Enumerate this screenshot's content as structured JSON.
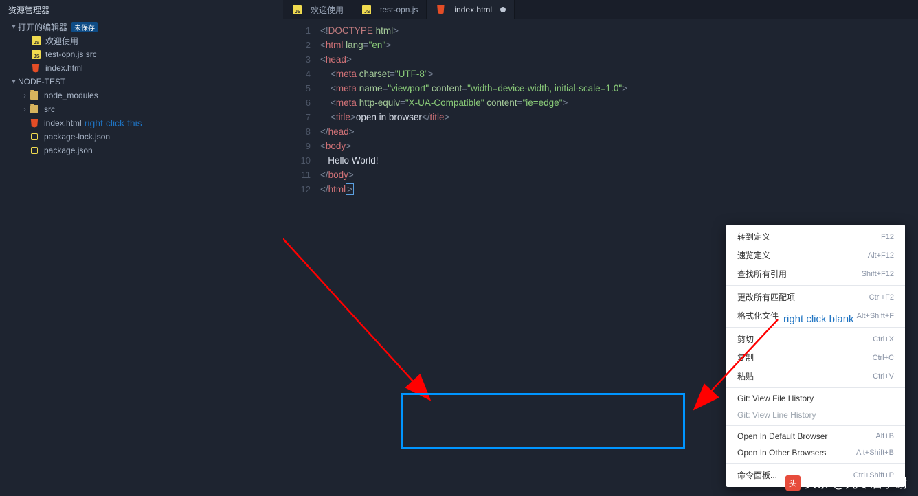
{
  "sidebar": {
    "title": "资源管理器",
    "sections": {
      "openEditors": {
        "label": "打开的编辑器",
        "badge": "未保存"
      },
      "items": [
        {
          "icon": "js",
          "label": "欢迎使用"
        },
        {
          "icon": "js",
          "label": "test-opn.js src"
        },
        {
          "icon": "html5",
          "label": "index.html"
        }
      ],
      "workspace": "NODE-TEST",
      "wsItems": [
        {
          "icon": "folder",
          "label": "node_modules",
          "chev": "›"
        },
        {
          "icon": "folder",
          "label": "src",
          "chev": "›"
        },
        {
          "icon": "html5",
          "label": "index.html",
          "selected": true,
          "annotation": "right click this"
        },
        {
          "icon": "json",
          "label": "package-lock.json"
        },
        {
          "icon": "json",
          "label": "package.json"
        }
      ]
    }
  },
  "tabs": [
    {
      "icon": "js",
      "label": "欢迎使用"
    },
    {
      "icon": "js",
      "label": "test-opn.js"
    },
    {
      "icon": "html5",
      "label": "index.html",
      "active": true,
      "dirty": true
    }
  ],
  "code": {
    "lines": [
      {
        "n": 1,
        "html": [
          [
            "brkt",
            "<!"
          ],
          [
            "doctype",
            "DOCTYPE "
          ],
          [
            "attr",
            "html"
          ],
          [
            "brkt",
            ">"
          ]
        ]
      },
      {
        "n": 2,
        "html": [
          [
            "brkt",
            "<"
          ],
          [
            "tag",
            "html"
          ],
          [
            "txt",
            " "
          ],
          [
            "attr",
            "lang"
          ],
          [
            "brkt",
            "="
          ],
          [
            "str",
            "\"en\""
          ],
          [
            "brkt",
            ">"
          ]
        ]
      },
      {
        "n": 3,
        "html": [
          [
            "brkt",
            "<"
          ],
          [
            "tag",
            "head"
          ],
          [
            "brkt",
            ">"
          ]
        ]
      },
      {
        "n": 4,
        "html": [
          [
            "txt",
            "    "
          ],
          [
            "brkt",
            "<"
          ],
          [
            "tag",
            "meta"
          ],
          [
            "txt",
            " "
          ],
          [
            "attr",
            "charset"
          ],
          [
            "brkt",
            "="
          ],
          [
            "str",
            "\"UTF-8\""
          ],
          [
            "brkt",
            ">"
          ]
        ]
      },
      {
        "n": 5,
        "html": [
          [
            "txt",
            "    "
          ],
          [
            "brkt",
            "<"
          ],
          [
            "tag",
            "meta"
          ],
          [
            "txt",
            " "
          ],
          [
            "attr",
            "name"
          ],
          [
            "brkt",
            "="
          ],
          [
            "str",
            "\"viewport\""
          ],
          [
            "txt",
            " "
          ],
          [
            "attr",
            "content"
          ],
          [
            "brkt",
            "="
          ],
          [
            "str",
            "\"width=device-width, initial-scale=1.0\""
          ],
          [
            "brkt",
            ">"
          ]
        ]
      },
      {
        "n": 6,
        "html": [
          [
            "txt",
            "    "
          ],
          [
            "brkt",
            "<"
          ],
          [
            "tag",
            "meta"
          ],
          [
            "txt",
            " "
          ],
          [
            "attr",
            "http-equiv"
          ],
          [
            "brkt",
            "="
          ],
          [
            "str",
            "\"X-UA-Compatible\""
          ],
          [
            "txt",
            " "
          ],
          [
            "attr",
            "content"
          ],
          [
            "brkt",
            "="
          ],
          [
            "str",
            "\"ie=edge\""
          ],
          [
            "brkt",
            ">"
          ]
        ]
      },
      {
        "n": 7,
        "html": [
          [
            "txt",
            "    "
          ],
          [
            "brkt",
            "<"
          ],
          [
            "tag",
            "title"
          ],
          [
            "brkt",
            ">"
          ],
          [
            "txt",
            "open in browser"
          ],
          [
            "brkt",
            "</"
          ],
          [
            "tag",
            "title"
          ],
          [
            "brkt",
            ">"
          ]
        ]
      },
      {
        "n": 8,
        "html": [
          [
            "brkt",
            "</"
          ],
          [
            "tag",
            "head"
          ],
          [
            "brkt",
            ">"
          ]
        ]
      },
      {
        "n": 9,
        "html": [
          [
            "brkt",
            "<"
          ],
          [
            "tag",
            "body"
          ],
          [
            "brkt",
            ">"
          ]
        ]
      },
      {
        "n": 10,
        "html": [
          [
            "txt",
            "   Hello World!"
          ]
        ]
      },
      {
        "n": 11,
        "html": [
          [
            "brkt",
            "</"
          ],
          [
            "tag",
            "body"
          ],
          [
            "brkt",
            ">"
          ]
        ]
      },
      {
        "n": 12,
        "html": [
          [
            "brkt",
            "</"
          ],
          [
            "tag",
            "html"
          ],
          [
            "brkt",
            ">"
          ]
        ],
        "cursor": true
      }
    ]
  },
  "contextMenu": {
    "groups": [
      [
        {
          "label": "转到定义",
          "key": "F12"
        },
        {
          "label": "速览定义",
          "key": "Alt+F12"
        },
        {
          "label": "查找所有引用",
          "key": "Shift+F12"
        }
      ],
      [
        {
          "label": "更改所有匹配项",
          "key": "Ctrl+F2"
        },
        {
          "label": "格式化文件",
          "key": "Alt+Shift+F"
        }
      ],
      [
        {
          "label": "剪切",
          "key": "Ctrl+X"
        },
        {
          "label": "复制",
          "key": "Ctrl+C"
        },
        {
          "label": "粘贴",
          "key": "Ctrl+V"
        }
      ],
      [
        {
          "label": "Git: View File History",
          "key": ""
        },
        {
          "label": "Git: View Line History",
          "key": "",
          "disabled": true
        }
      ],
      [
        {
          "label": "Open In Default Browser",
          "key": "Alt+B"
        },
        {
          "label": "Open In Other Browsers",
          "key": "Alt+Shift+B"
        }
      ],
      [
        {
          "label": "命令面板...",
          "key": "Ctrl+Shift+P"
        }
      ]
    ]
  },
  "annotations": {
    "rightClickBlank": "right click blank"
  },
  "credit": {
    "logo": "头",
    "text": "头条 @九零后小谢"
  }
}
